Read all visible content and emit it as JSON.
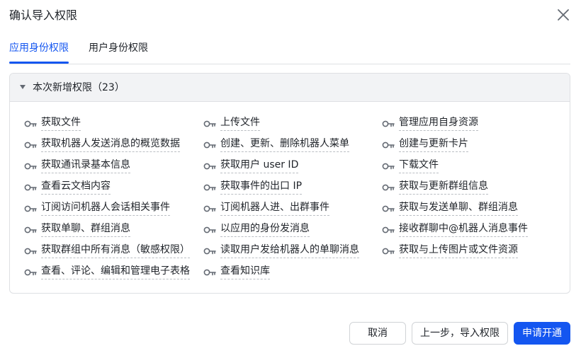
{
  "dialog": {
    "title": "确认导入权限"
  },
  "tabs": [
    {
      "label": "应用身份权限",
      "active": true
    },
    {
      "label": "用户身份权限",
      "active": false
    }
  ],
  "section": {
    "title": "本次新增权限（23）",
    "permissions": [
      [
        "获取文件",
        "上传文件",
        "管理应用自身资源"
      ],
      [
        "获取机器人发送消息的概览数据",
        "创建、更新、删除机器人菜单",
        "创建与更新卡片"
      ],
      [
        "获取通讯录基本信息",
        "获取用户 user ID",
        "下载文件"
      ],
      [
        "查看云文档内容",
        "获取事件的出口 IP",
        "获取与更新群组信息"
      ],
      [
        "订阅访问机器人会话相关事件",
        "订阅机器人进、出群事件",
        "获取与发送单聊、群组消息"
      ],
      [
        "获取单聊、群组消息",
        "以应用的身份发消息",
        "接收群聊中@机器人消息事件"
      ],
      [
        "获取群组中所有消息（敏感权限）",
        "读取用户发给机器人的单聊消息",
        "获取与上传图片或文件资源"
      ],
      [
        "查看、评论、编辑和管理电子表格",
        "查看知识库"
      ]
    ]
  },
  "footer": {
    "cancel_label": "取消",
    "prev_label": "上一步，导入权限",
    "apply_label": "申请开通"
  },
  "icons": {
    "close": "close-icon",
    "caret": "caret-down-icon",
    "key": "key-icon"
  },
  "colors": {
    "accent": "#1456f0",
    "text": "#1f2329",
    "muted_icon": "#646a73"
  }
}
